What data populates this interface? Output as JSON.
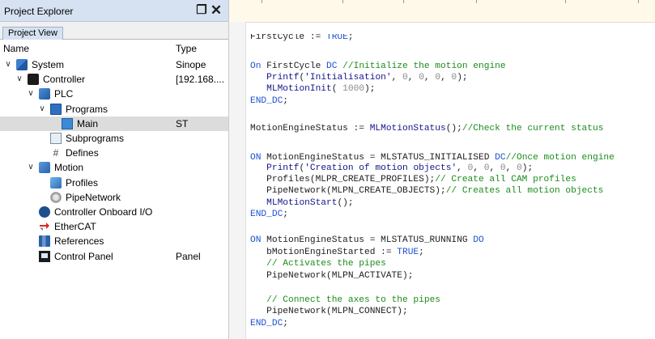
{
  "explorer": {
    "title": "Project Explorer",
    "pin_icon": "pin-icon",
    "close_icon": "close-icon",
    "tab": "Project View",
    "columns": {
      "name": "Name",
      "type": "Type"
    },
    "items": [
      {
        "label": "System",
        "type": "Sinope",
        "icon": "system-icon",
        "level": 0,
        "chev": "∨"
      },
      {
        "label": "Controller",
        "type": "[192.168....",
        "icon": "controller-icon",
        "level": 1,
        "chev": "∨"
      },
      {
        "label": "PLC",
        "type": "",
        "icon": "plc-icon",
        "level": 2,
        "chev": "∨"
      },
      {
        "label": "Programs",
        "type": "",
        "icon": "programs-folder-icon",
        "level": 3,
        "chev": "∨"
      },
      {
        "label": "Main",
        "type": "ST",
        "icon": "program-file-icon",
        "level": 4,
        "chev": ""
      },
      {
        "label": "Subprograms",
        "type": "",
        "icon": "subprograms-icon",
        "level": 3,
        "chev": ""
      },
      {
        "label": "Defines",
        "type": "",
        "icon": "defines-icon",
        "level": 3,
        "chev": ""
      },
      {
        "label": "Motion",
        "type": "",
        "icon": "motion-icon",
        "level": 2,
        "chev": "∨"
      },
      {
        "label": "Profiles",
        "type": "",
        "icon": "profiles-icon",
        "level": 3,
        "chev": ""
      },
      {
        "label": "PipeNetwork",
        "type": "",
        "icon": "pipenetwork-icon",
        "level": 3,
        "chev": ""
      },
      {
        "label": "Controller Onboard I/O",
        "type": "",
        "icon": "onboard-io-icon",
        "level": 2,
        "chev": ""
      },
      {
        "label": "EtherCAT",
        "type": "",
        "icon": "ethercat-icon",
        "level": 2,
        "chev": ""
      },
      {
        "label": "References",
        "type": "",
        "icon": "references-icon",
        "level": 2,
        "chev": ""
      },
      {
        "label": "Control Panel",
        "type": "Panel",
        "icon": "control-panel-icon",
        "level": 2,
        "chev": ""
      }
    ]
  },
  "editor": {
    "colors": {
      "keyword": "#1e50d2",
      "function": "#14148c",
      "comment": "#1c8c1c",
      "number": "#8a8a8a"
    },
    "lines": [
      [
        [
          "t",
          "FirstCycle := "
        ],
        [
          "k",
          "TRUE"
        ],
        [
          "t",
          ";"
        ]
      ],
      [],
      [
        [
          "k",
          "On"
        ],
        [
          "t",
          " FirstCycle "
        ],
        [
          "k",
          "DC"
        ],
        [
          "t",
          " "
        ],
        [
          "c",
          "//Initialize the motion engine"
        ]
      ],
      [
        [
          "t",
          "   "
        ],
        [
          "f",
          "Printf"
        ],
        [
          "t",
          "("
        ],
        [
          "s",
          "'Initialisation'"
        ],
        [
          "t",
          ", "
        ],
        [
          "n",
          "0"
        ],
        [
          "t",
          ", "
        ],
        [
          "n",
          "0"
        ],
        [
          "t",
          ", "
        ],
        [
          "n",
          "0"
        ],
        [
          "t",
          ", "
        ],
        [
          "n",
          "0"
        ],
        [
          "t",
          ");"
        ]
      ],
      [
        [
          "t",
          "   "
        ],
        [
          "f",
          "MLMotionInit"
        ],
        [
          "t",
          "( "
        ],
        [
          "n",
          "1000"
        ],
        [
          "t",
          ");"
        ]
      ],
      [
        [
          "k",
          "END_DC"
        ],
        [
          "t",
          ";"
        ]
      ],
      [],
      [
        [
          "t",
          "MotionEngineStatus := "
        ],
        [
          "f",
          "MLMotionStatus"
        ],
        [
          "t",
          "();"
        ],
        [
          "c",
          "//Check the current status"
        ]
      ],
      [],
      [
        [
          "k",
          "ON"
        ],
        [
          "t",
          " MotionEngineStatus = MLSTATUS_INITIALISED "
        ],
        [
          "k",
          "DC"
        ],
        [
          "c",
          "//Once motion engine"
        ]
      ],
      [
        [
          "t",
          "   "
        ],
        [
          "f",
          "Printf"
        ],
        [
          "t",
          "("
        ],
        [
          "s",
          "'Creation of motion objects'"
        ],
        [
          "t",
          ", "
        ],
        [
          "n",
          "0"
        ],
        [
          "t",
          ", "
        ],
        [
          "n",
          "0"
        ],
        [
          "t",
          ", "
        ],
        [
          "n",
          "0"
        ],
        [
          "t",
          ", "
        ],
        [
          "n",
          "0"
        ],
        [
          "t",
          ");"
        ]
      ],
      [
        [
          "t",
          "   Profiles(MLPR_CREATE_PROFILES);"
        ],
        [
          "c",
          "// Create all CAM profiles"
        ]
      ],
      [
        [
          "t",
          "   PipeNetwork(MLPN_CREATE_OBJECTS);"
        ],
        [
          "c",
          "// Creates all motion objects"
        ]
      ],
      [
        [
          "t",
          "   "
        ],
        [
          "f",
          "MLMotionStart"
        ],
        [
          "t",
          "();"
        ]
      ],
      [
        [
          "k",
          "END_DC"
        ],
        [
          "t",
          ";"
        ]
      ],
      [],
      [
        [
          "k",
          "ON"
        ],
        [
          "t",
          " MotionEngineStatus = MLSTATUS_RUNNING "
        ],
        [
          "k",
          "DO"
        ]
      ],
      [
        [
          "t",
          "   bMotionEngineStarted := "
        ],
        [
          "k",
          "TRUE"
        ],
        [
          "t",
          ";"
        ]
      ],
      [
        [
          "t",
          "   "
        ],
        [
          "c",
          "// Activates the pipes"
        ]
      ],
      [
        [
          "t",
          "   PipeNetwork(MLPN_ACTIVATE);"
        ]
      ],
      [],
      [
        [
          "t",
          "   "
        ],
        [
          "c",
          "// Connect the axes to the pipes"
        ]
      ],
      [
        [
          "t",
          "   PipeNetwork(MLPN_CONNECT);"
        ]
      ],
      [
        [
          "k",
          "END_DC"
        ],
        [
          "t",
          ";"
        ]
      ]
    ]
  }
}
